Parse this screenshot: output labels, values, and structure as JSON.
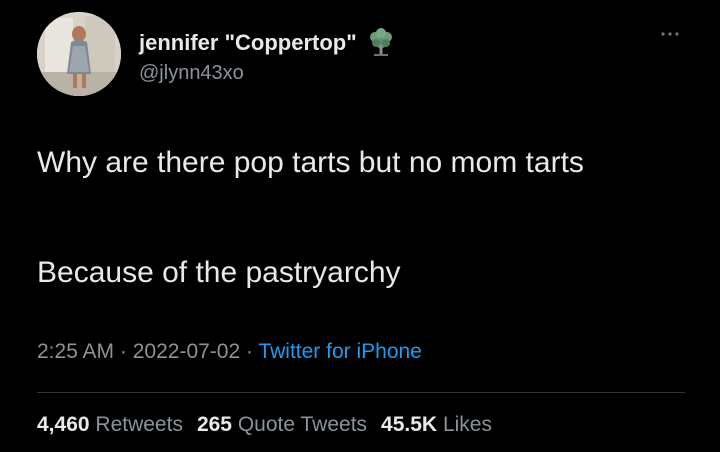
{
  "user": {
    "display_name": "jennifer \"Coppertop\"",
    "handle": "@jlynn43xo",
    "badge_icon": "tree-emoji-icon",
    "avatar_icon": "profile-photo"
  },
  "tweet": {
    "line1": "Why are there pop tarts but no mom tarts",
    "line2": "Because of the pastryarchy"
  },
  "meta": {
    "time": "2:25 AM",
    "sep1": " · ",
    "date": "2022-07-02",
    "sep2": " · ",
    "source": "Twitter for iPhone"
  },
  "stats": {
    "retweets_count": "4,460",
    "retweets_label": "Retweets",
    "quotes_count": "265",
    "quotes_label": "Quote Tweets",
    "likes_count": "45.5K",
    "likes_label": "Likes"
  },
  "colors": {
    "background": "#000000",
    "text": "#e7e9ea",
    "secondary": "#8b9299",
    "link": "#1d9bf0",
    "divider": "#2f3336"
  },
  "menu_icon": "more-options-icon"
}
